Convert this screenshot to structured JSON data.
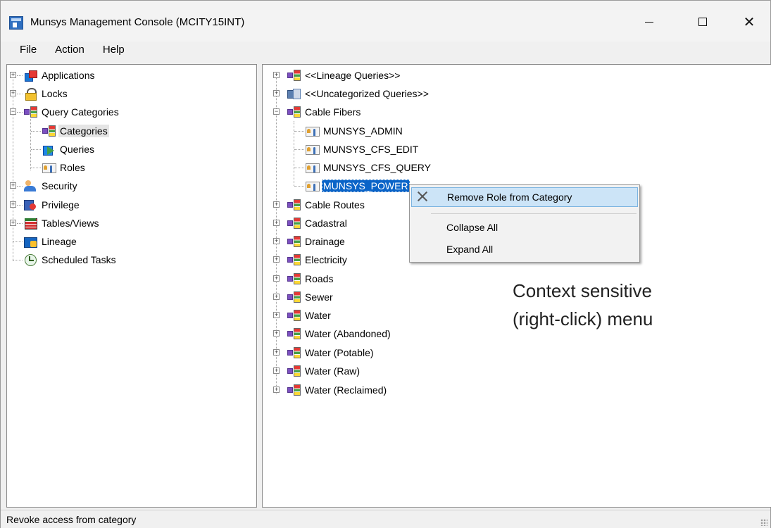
{
  "window": {
    "title": "Munsys Management Console (MCITY15INT)",
    "controls": {
      "minimize": "—",
      "maximize": "☐",
      "close": "✕"
    }
  },
  "menubar": {
    "items": [
      "File",
      "Action",
      "Help"
    ]
  },
  "left_tree": {
    "items": [
      {
        "label": "Applications",
        "icon": "applications-icon",
        "expander": "+"
      },
      {
        "label": "Locks",
        "icon": "lock-icon",
        "expander": "+"
      },
      {
        "label": "Query Categories",
        "icon": "category-icon",
        "expander": "−"
      },
      {
        "label": "Categories",
        "icon": "category-icon",
        "selected": true
      },
      {
        "label": "Queries",
        "icon": "query-icon"
      },
      {
        "label": "Roles",
        "icon": "role-icon"
      },
      {
        "label": "Security",
        "icon": "security-icon",
        "expander": "+"
      },
      {
        "label": "Privilege",
        "icon": "privilege-icon",
        "expander": "+"
      },
      {
        "label": "Tables/Views",
        "icon": "table-icon",
        "expander": "+"
      },
      {
        "label": "Lineage",
        "icon": "lineage-icon"
      },
      {
        "label": "Scheduled Tasks",
        "icon": "scheduled-task-icon"
      }
    ]
  },
  "right_tree": {
    "items": [
      {
        "label": "<<Lineage Queries>>",
        "icon": "category-icon",
        "expander": "+"
      },
      {
        "label": "<<Uncategorized Queries>>",
        "icon": "uncategorized-icon",
        "expander": "+"
      },
      {
        "label": "Cable Fibers",
        "icon": "category-icon",
        "expander": "−"
      },
      {
        "label": "MUNSYS_ADMIN",
        "icon": "role-icon"
      },
      {
        "label": "MUNSYS_CFS_EDIT",
        "icon": "role-icon"
      },
      {
        "label": "MUNSYS_CFS_QUERY",
        "icon": "role-icon"
      },
      {
        "label": "MUNSYS_POWER",
        "icon": "role-icon",
        "selected": true
      },
      {
        "label": "Cable Routes",
        "icon": "category-icon",
        "expander": "+"
      },
      {
        "label": "Cadastral",
        "icon": "category-icon",
        "expander": "+"
      },
      {
        "label": "Drainage",
        "icon": "category-icon",
        "expander": "+"
      },
      {
        "label": "Electricity",
        "icon": "category-icon",
        "expander": "+"
      },
      {
        "label": "Roads",
        "icon": "category-icon",
        "expander": "+"
      },
      {
        "label": "Sewer",
        "icon": "category-icon",
        "expander": "+"
      },
      {
        "label": "Water",
        "icon": "category-icon",
        "expander": "+"
      },
      {
        "label": "Water (Abandoned)",
        "icon": "category-icon",
        "expander": "+"
      },
      {
        "label": "Water (Potable)",
        "icon": "category-icon",
        "expander": "+"
      },
      {
        "label": "Water (Raw)",
        "icon": "category-icon",
        "expander": "+"
      },
      {
        "label": "Water (Reclaimed)",
        "icon": "category-icon",
        "expander": "+"
      }
    ]
  },
  "context_menu": {
    "items": [
      {
        "label": "Remove Role from Category",
        "icon": "remove-x-icon",
        "highlighted": true
      },
      {
        "label": "Collapse All"
      },
      {
        "label": "Expand All"
      }
    ]
  },
  "annotation": {
    "line1": "Context sensitive",
    "line2": "(right-click) menu"
  },
  "statusbar": {
    "text": "Revoke access from category"
  }
}
